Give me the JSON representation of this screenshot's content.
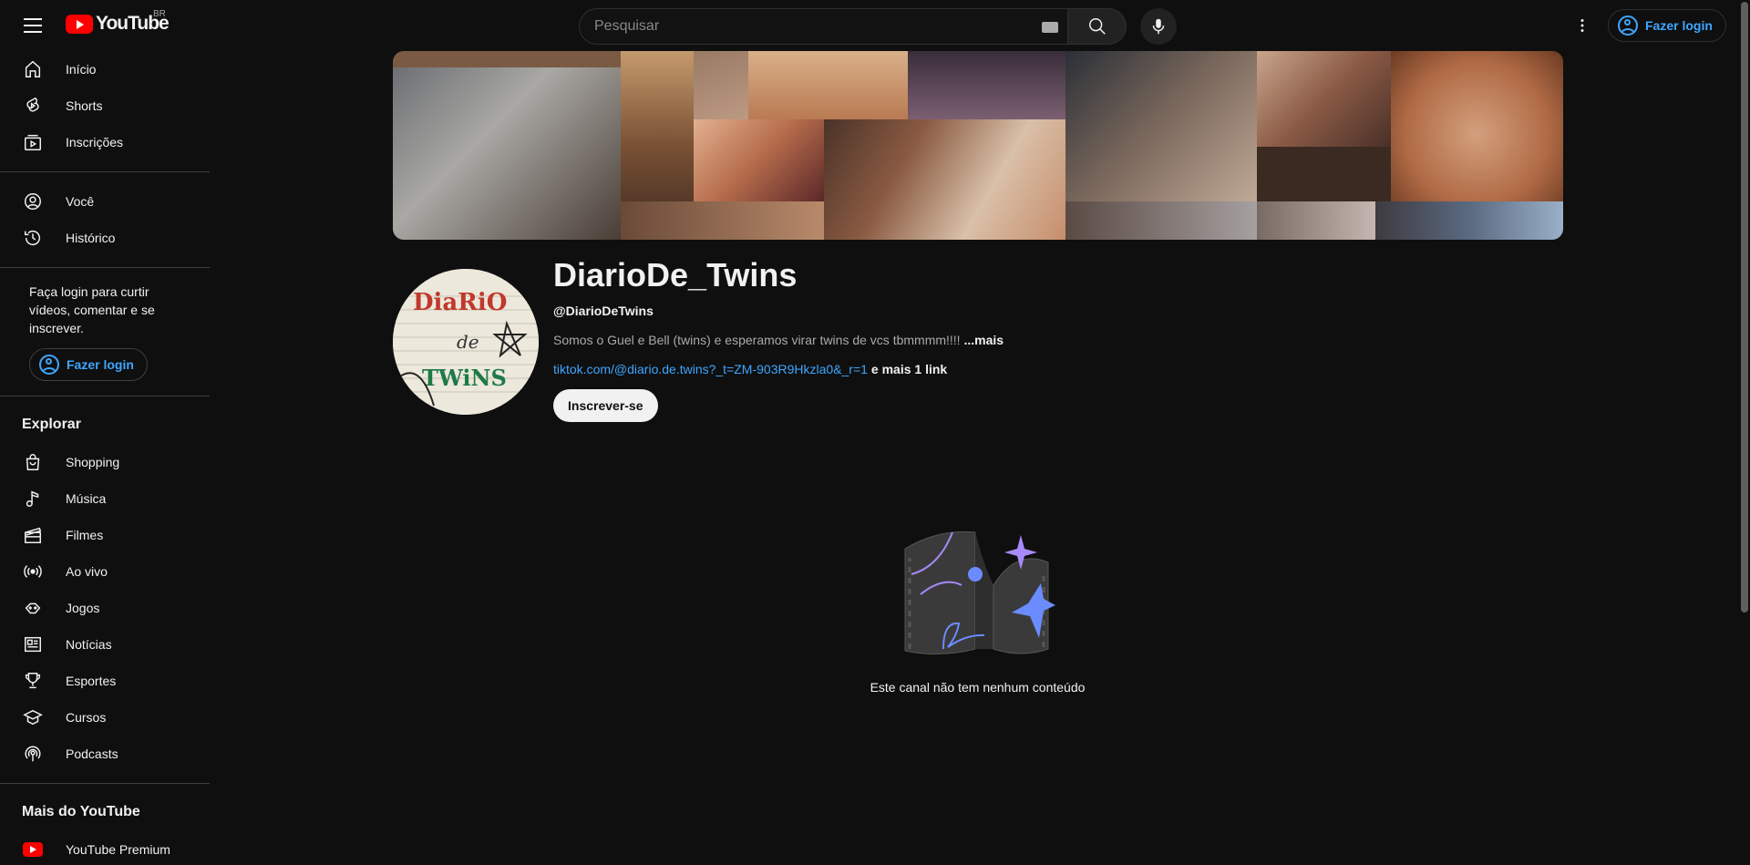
{
  "header": {
    "logo_text": "YouTube",
    "country_code": "BR",
    "search_placeholder": "Pesquisar",
    "login_label": "Fazer login"
  },
  "sidebar": {
    "main_items": [
      {
        "label": "Início",
        "icon": "home-icon"
      },
      {
        "label": "Shorts",
        "icon": "shorts-icon"
      },
      {
        "label": "Inscrições",
        "icon": "subscriptions-icon"
      }
    ],
    "you_items": [
      {
        "label": "Você",
        "icon": "you-icon"
      },
      {
        "label": "Histórico",
        "icon": "history-icon"
      }
    ],
    "login_prompt": "Faça login para curtir vídeos, comentar e se inscrever.",
    "login_label": "Fazer login",
    "explore_heading": "Explorar",
    "explore_items": [
      {
        "label": "Shopping",
        "icon": "shopping-icon"
      },
      {
        "label": "Música",
        "icon": "music-icon"
      },
      {
        "label": "Filmes",
        "icon": "movies-icon"
      },
      {
        "label": "Ao vivo",
        "icon": "live-icon"
      },
      {
        "label": "Jogos",
        "icon": "gaming-icon"
      },
      {
        "label": "Notícias",
        "icon": "news-icon"
      },
      {
        "label": "Esportes",
        "icon": "sports-icon"
      },
      {
        "label": "Cursos",
        "icon": "courses-icon"
      },
      {
        "label": "Podcasts",
        "icon": "podcasts-icon"
      }
    ],
    "more_heading": "Mais do YouTube",
    "more_items": [
      {
        "label": "YouTube Premium",
        "icon": "youtube-premium-icon"
      }
    ]
  },
  "channel": {
    "name": "DiarioDe_Twins",
    "handle": "@DiarioDeTwins",
    "description": "Somos o Guel e Bell (twins) e esperamos virar twins de vcs tbmmmm!!!! ",
    "description_more": "...mais",
    "link": "tiktok.com/@diario.de.twins?_t=ZM-903R9Hkzla0&_r=1",
    "more_links": "e mais 1 link",
    "subscribe_label": "Inscrever-se",
    "avatar_text": [
      "DiaRiO",
      "de",
      "TWiNS"
    ]
  },
  "empty_state": {
    "message": "Este canal não tem nenhum conteúdo"
  },
  "colors": {
    "background": "#0f0f0f",
    "accent_link": "#3ea6ff",
    "logo_red": "#ff0000"
  }
}
